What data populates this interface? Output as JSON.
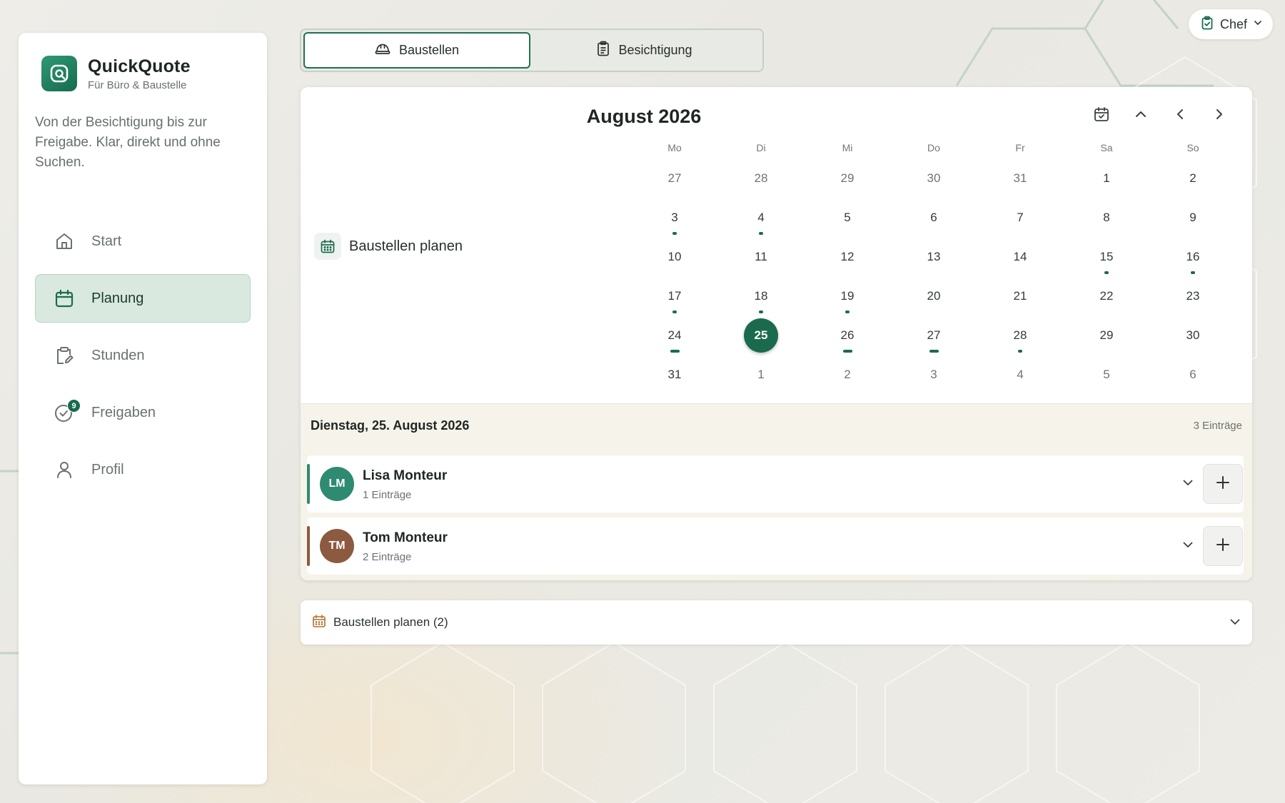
{
  "app": {
    "title": "QuickQuote",
    "subtitle": "Für Büro & Baustelle",
    "intro": "Von der Besichtigung bis zur Freigabe. Klar, direkt und ohne Suchen."
  },
  "nav": [
    {
      "label": "Start",
      "icon": "home-icon",
      "active": false
    },
    {
      "label": "Planung",
      "icon": "calendar-icon",
      "active": true
    },
    {
      "label": "Stunden",
      "icon": "clipboard-edit-icon",
      "active": false
    },
    {
      "label": "Freigaben",
      "icon": "check-circle-icon",
      "active": false,
      "badge": "9"
    },
    {
      "label": "Profil",
      "icon": "user-icon",
      "active": false
    }
  ],
  "user_menu": {
    "label": "Chef",
    "icon": "clipboard-check-icon"
  },
  "tabs": [
    {
      "label": "Baustellen",
      "icon": "hard-hat-icon",
      "active": true
    },
    {
      "label": "Besichtigung",
      "icon": "clipboard-icon",
      "active": false
    }
  ],
  "planner": {
    "label": "Baustellen planen",
    "icon": "calendar-icon"
  },
  "calendar": {
    "month": "August 2026",
    "weekdays": [
      "Mo",
      "Di",
      "Mi",
      "Do",
      "Fr",
      "Sa",
      "So"
    ],
    "weeks": [
      [
        {
          "d": "27",
          "out": true
        },
        {
          "d": "28",
          "out": true
        },
        {
          "d": "29",
          "out": true
        },
        {
          "d": "30",
          "out": true
        },
        {
          "d": "31",
          "out": true
        },
        {
          "d": "1"
        },
        {
          "d": "2"
        }
      ],
      [
        {
          "d": "3",
          "mark": "dot"
        },
        {
          "d": "4",
          "mark": "dot"
        },
        {
          "d": "5"
        },
        {
          "d": "6"
        },
        {
          "d": "7"
        },
        {
          "d": "8"
        },
        {
          "d": "9"
        }
      ],
      [
        {
          "d": "10"
        },
        {
          "d": "11"
        },
        {
          "d": "12"
        },
        {
          "d": "13"
        },
        {
          "d": "14"
        },
        {
          "d": "15",
          "mark": "dot"
        },
        {
          "d": "16",
          "mark": "dot"
        }
      ],
      [
        {
          "d": "17",
          "mark": "dot"
        },
        {
          "d": "18",
          "mark": "dot"
        },
        {
          "d": "19",
          "mark": "dot"
        },
        {
          "d": "20"
        },
        {
          "d": "21"
        },
        {
          "d": "22"
        },
        {
          "d": "23"
        }
      ],
      [
        {
          "d": "24",
          "mark": "bar"
        },
        {
          "d": "25",
          "today": true,
          "mark": "dot"
        },
        {
          "d": "26",
          "mark": "bar"
        },
        {
          "d": "27",
          "mark": "bar"
        },
        {
          "d": "28",
          "mark": "dot"
        },
        {
          "d": "29"
        },
        {
          "d": "30"
        }
      ],
      [
        {
          "d": "31"
        },
        {
          "d": "1",
          "out": true
        },
        {
          "d": "2",
          "out": true
        },
        {
          "d": "3",
          "out": true
        },
        {
          "d": "4",
          "out": true
        },
        {
          "d": "5",
          "out": true
        },
        {
          "d": "6",
          "out": true
        }
      ]
    ]
  },
  "selected_day": {
    "title": "Dienstag, 25. August 2026",
    "count": "3 Einträge",
    "people": [
      {
        "initials": "LM",
        "name": "Lisa Monteur",
        "entries": "1 Einträge",
        "color": "#2e8a70"
      },
      {
        "initials": "TM",
        "name": "Tom Monteur",
        "entries": "2 Einträge",
        "color": "#8b5a3f"
      }
    ]
  },
  "collapsible": {
    "label": "Baustellen planen (2)"
  },
  "colors": {
    "accent": "#1a6b4d",
    "accent_light": "#d9e9e0"
  }
}
